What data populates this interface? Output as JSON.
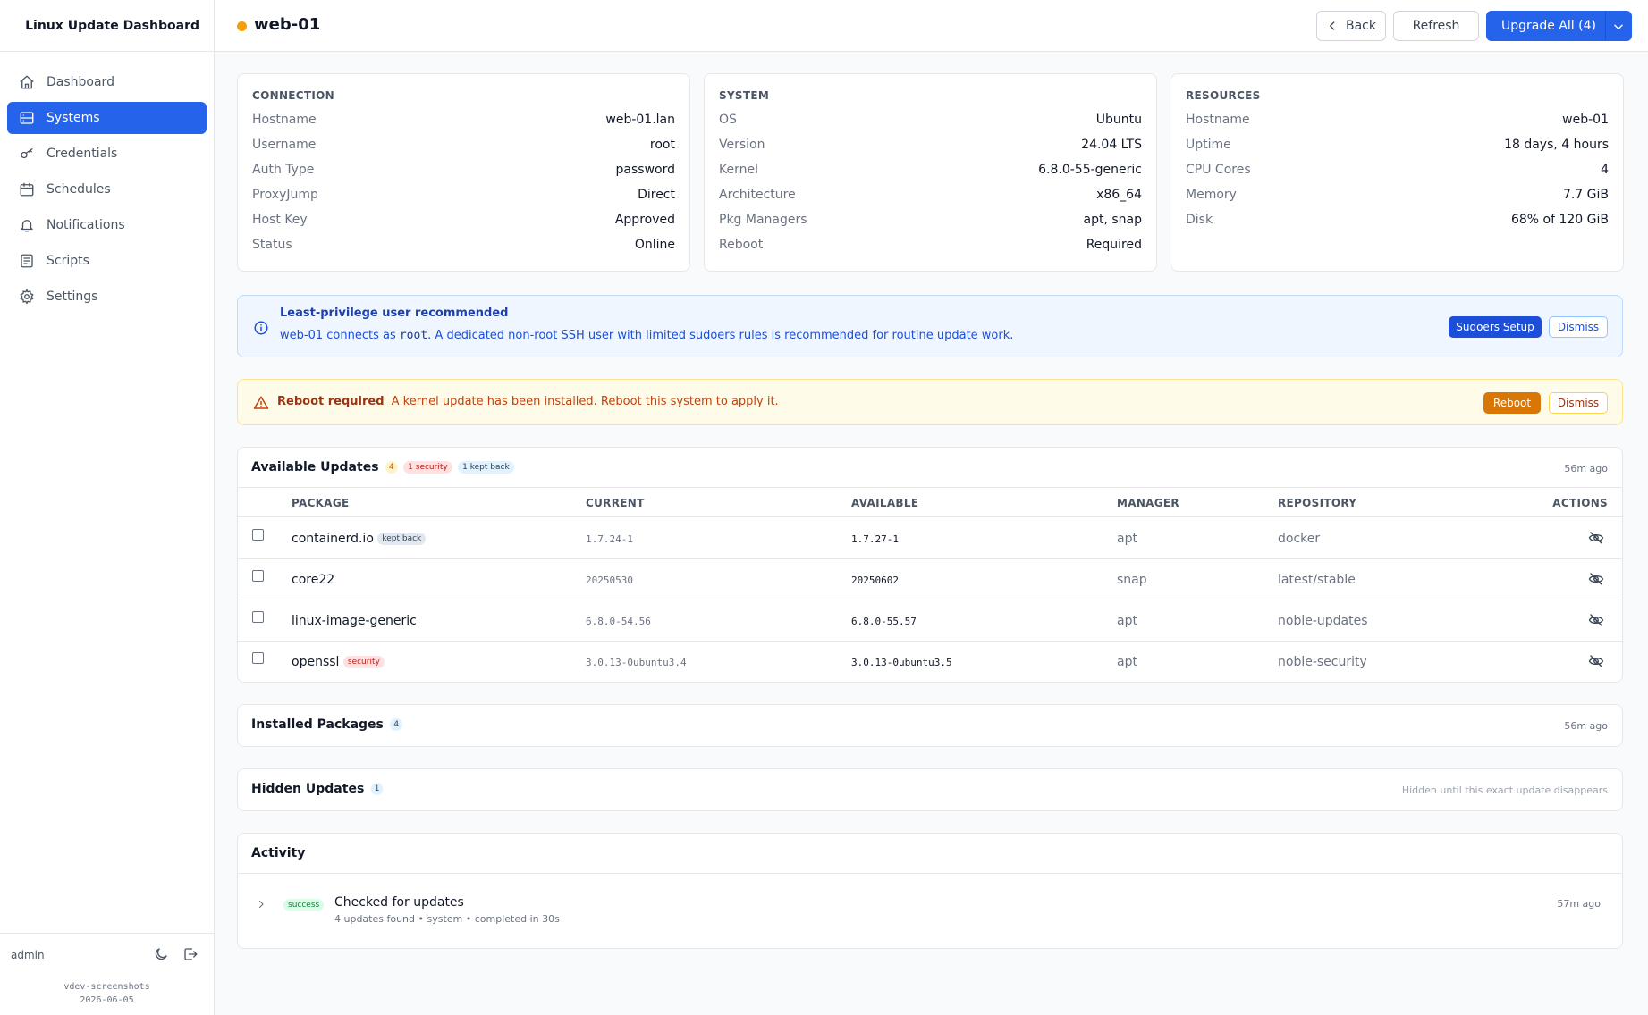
{
  "app": {
    "title": "Linux Update Dashboard"
  },
  "sidebar": {
    "items": [
      {
        "label": "Dashboard",
        "icon": "home-icon"
      },
      {
        "label": "Systems",
        "icon": "server-icon",
        "active": true
      },
      {
        "label": "Credentials",
        "icon": "key-icon"
      },
      {
        "label": "Schedules",
        "icon": "calendar-icon"
      },
      {
        "label": "Notifications",
        "icon": "bell-icon"
      },
      {
        "label": "Scripts",
        "icon": "script-icon"
      },
      {
        "label": "Settings",
        "icon": "gear-icon"
      }
    ],
    "footer": {
      "user": "admin",
      "version_line1": "vdev-screenshots",
      "version_line2": "2026-06-05"
    }
  },
  "header": {
    "host": "web-01",
    "status_color": "#f59e0b",
    "back_label": "Back",
    "refresh_label": "Refresh",
    "upgrade_label": "Upgrade All (4)"
  },
  "connection": {
    "heading": "CONNECTION",
    "rows": [
      {
        "label": "Hostname",
        "value": "web-01.lan"
      },
      {
        "label": "Username",
        "value": "root"
      },
      {
        "label": "Auth Type",
        "value": "password"
      },
      {
        "label": "ProxyJump",
        "value": "Direct"
      },
      {
        "label": "Host Key",
        "value": "Approved"
      },
      {
        "label": "Status",
        "value": "Online"
      }
    ]
  },
  "system": {
    "heading": "SYSTEM",
    "rows": [
      {
        "label": "OS",
        "value": "Ubuntu"
      },
      {
        "label": "Version",
        "value": "24.04 LTS"
      },
      {
        "label": "Kernel",
        "value": "6.8.0-55-generic"
      },
      {
        "label": "Architecture",
        "value": "x86_64"
      },
      {
        "label": "Pkg Managers",
        "value": "apt, snap"
      },
      {
        "label": "Reboot",
        "value": "Required"
      }
    ]
  },
  "resources": {
    "heading": "RESOURCES",
    "rows": [
      {
        "label": "Hostname",
        "value": "web-01"
      },
      {
        "label": "Uptime",
        "value": "18 days, 4 hours"
      },
      {
        "label": "CPU Cores",
        "value": "4"
      },
      {
        "label": "Memory",
        "value": "7.7 GiB"
      },
      {
        "label": "Disk",
        "value": "68% of 120 GiB"
      }
    ]
  },
  "privilege_banner": {
    "title": "Least-privilege user recommended",
    "text_before": "web-01 connects as ",
    "user_code": "root",
    "text_after": ". A dedicated non-root SSH user with limited sudoers rules is recommended for routine update work.",
    "setup_label": "Sudoers Setup",
    "dismiss_label": "Dismiss"
  },
  "reboot_banner": {
    "title": "Reboot required",
    "text": "A kernel update has been installed. Reboot this system to apply it.",
    "reboot_label": "Reboot",
    "dismiss_label": "Dismiss"
  },
  "updates": {
    "title": "Available Updates",
    "count": "4",
    "security_badge": "1 security",
    "kept_back_badge": "1 kept back",
    "ago": "56m ago",
    "columns": {
      "package": "PACKAGE",
      "current": "CURRENT",
      "available": "AVAILABLE",
      "manager": "MANAGER",
      "repository": "REPOSITORY",
      "actions": "ACTIONS"
    },
    "rows": [
      {
        "package": "containerd.io",
        "tag": "kept back",
        "current": "1.7.24-1",
        "available": "1.7.27-1",
        "manager": "apt",
        "repository": "docker"
      },
      {
        "package": "core22",
        "tag": "",
        "current": "20250530",
        "available": "20250602",
        "manager": "snap",
        "repository": "latest/stable"
      },
      {
        "package": "linux-image-generic",
        "tag": "",
        "current": "6.8.0-54.56",
        "available": "6.8.0-55.57",
        "manager": "apt",
        "repository": "noble-updates"
      },
      {
        "package": "openssl",
        "tag": "security",
        "current": "3.0.13-0ubuntu3.4",
        "available": "3.0.13-0ubuntu3.5",
        "manager": "apt",
        "repository": "noble-security"
      }
    ]
  },
  "installed": {
    "title": "Installed Packages",
    "count": "4",
    "ago": "56m ago"
  },
  "hidden": {
    "title": "Hidden Updates",
    "count": "1",
    "note": "Hidden until this exact update disappears"
  },
  "activity": {
    "title": "Activity",
    "entries": [
      {
        "status": "success",
        "title": "Checked for updates",
        "detail": "4 updates found • system • completed in 30s",
        "ago": "57m ago"
      }
    ]
  }
}
